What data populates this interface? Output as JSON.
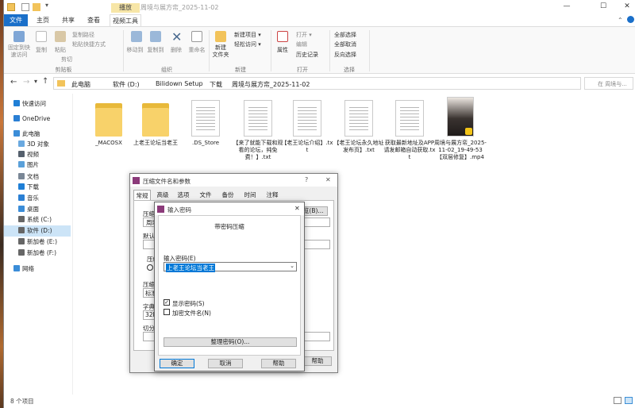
{
  "window": {
    "title": "周境与展方帟_2025-11-02",
    "context_tab": "播放",
    "controls": {
      "minimize": "—",
      "maximize": "☐",
      "close": "✕"
    }
  },
  "ribbon_tabs": [
    "文件",
    "主页",
    "共享",
    "查看",
    "视频工具"
  ],
  "ribbon": {
    "clipboard": {
      "label": "剪贴板",
      "pin": "固定到快\n速访问",
      "copy": "复制",
      "paste": "粘贴",
      "copy_path": "复制路径",
      "paste_shortcut": "粘贴快捷方式",
      "cut": "剪切"
    },
    "organize": {
      "label": "组织",
      "move_to": "移动到",
      "copy_to": "复制到",
      "delete": "删除",
      "rename": "重命名"
    },
    "new": {
      "label": "新建",
      "new_folder": "新建\n文件夹",
      "new_item": "新建项目 ▾",
      "easy_access": "轻松访问 ▾"
    },
    "open": {
      "label": "打开",
      "properties": "属性",
      "open": "打开 ▾",
      "edit": "编辑",
      "history": "历史记录"
    },
    "select": {
      "label": "选择",
      "select_all": "全部选择",
      "select_none": "全部取消",
      "invert": "反向选择"
    }
  },
  "address": {
    "crumbs": [
      "此电脑",
      "软件 (D:)",
      "Bilidown Setup",
      "下载",
      "周境与展方帟_2025-11-02"
    ],
    "search_placeholder": "在 周境与..."
  },
  "nav": [
    {
      "label": "快速访问",
      "icon": "star-icon",
      "color": "#1f7fd6"
    },
    {
      "label": "OneDrive",
      "icon": "cloud-icon",
      "color": "#2a7fd4"
    },
    {
      "label": "此电脑",
      "icon": "computer-icon",
      "color": "#3b8dd8"
    },
    {
      "label": "3D 对象",
      "icon": "cube-icon",
      "color": "#6aa9e0"
    },
    {
      "label": "视频",
      "icon": "video-icon",
      "color": "#55606d"
    },
    {
      "label": "图片",
      "icon": "picture-icon",
      "color": "#5aa0d9"
    },
    {
      "label": "文档",
      "icon": "document-icon",
      "color": "#7a8796"
    },
    {
      "label": "下载",
      "icon": "download-icon",
      "color": "#1f7fd6"
    },
    {
      "label": "音乐",
      "icon": "music-icon",
      "color": "#2a7fd4"
    },
    {
      "label": "桌面",
      "icon": "desktop-icon",
      "color": "#3b8dd8"
    },
    {
      "label": "系统 (C:)",
      "icon": "drive-icon",
      "color": "#666"
    },
    {
      "label": "软件 (D:)",
      "icon": "drive-icon",
      "color": "#666"
    },
    {
      "label": "新加卷 (E:)",
      "icon": "drive-icon",
      "color": "#666"
    },
    {
      "label": "新加卷 (F:)",
      "icon": "drive-icon",
      "color": "#666"
    },
    {
      "label": "网络",
      "icon": "network-icon",
      "color": "#3b8dd8"
    }
  ],
  "files": [
    {
      "name": "_MACOSX",
      "kind": "folder"
    },
    {
      "name": "上老王论坛当老王",
      "kind": "folder"
    },
    {
      "name": ".DS_Store",
      "kind": "doc"
    },
    {
      "name": "【来了就能下载和观看的论坛，纯免费！】.txt",
      "kind": "doc"
    },
    {
      "name": "【老王论坛介绍】.txt",
      "kind": "doc"
    },
    {
      "name": "【老王论坛永久地址发布页】.txt",
      "kind": "doc"
    },
    {
      "name": "获取最新地址及APP请发邮箱自动获取.txt",
      "kind": "doc"
    },
    {
      "name": "周境与展方帟_2025-11-02_19-49-53【双层修复】.mp4",
      "kind": "video"
    }
  ],
  "status": {
    "count": "8 个项目"
  },
  "archive_dialog": {
    "title": "压缩文件名和参数",
    "help": "?",
    "close": "✕",
    "tabs": [
      "常规",
      "高级",
      "选项",
      "文件",
      "备份",
      "时间",
      "注释"
    ],
    "stubs": {
      "r1": "压缩",
      "r2": "周境",
      "r3": "默认",
      "r4": "压缩",
      "r5": "压缩",
      "r6": "标准",
      "r7": "字典",
      "r8": "32M",
      "r9": "切分",
      "browse": "浏览(B)..."
    },
    "help_button": "帮助"
  },
  "password_dialog": {
    "title": "输入密码",
    "close": "✕",
    "heading": "带密码压缩",
    "field_label": "输入密码(E)",
    "field_value": "上老王论坛当老王",
    "show_password": "显示密码(S)",
    "show_password_checked": true,
    "encrypt_names": "加密文件名(N)",
    "encrypt_names_checked": false,
    "organize_button": "整理密码(O)...",
    "ok_button": "确定",
    "cancel_button": "取消",
    "help_button": "帮助"
  }
}
